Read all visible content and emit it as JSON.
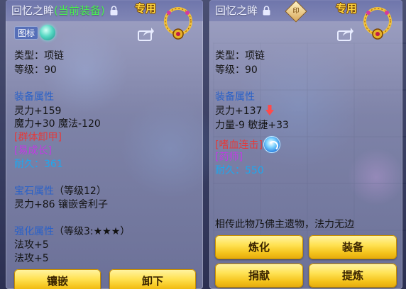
{
  "left_panel": {
    "title_name": "回忆之眸",
    "title_status": "(当前装备)",
    "exclusive_tag": "专用",
    "icon_label": "图标",
    "type": "类型：项链",
    "level": "等级：90",
    "equip_attr_header": "装备属性",
    "stat1": "灵力+159",
    "stat2": "魔力+30 魔法-120",
    "special_effect": "[群体卸甲]",
    "special_skill": "[易成长]",
    "durability_label": "耐久：",
    "durability_value": "361",
    "gem_header": "宝石属性",
    "gem_level": "（等级12）",
    "gem_stat": "灵力+86 镶嵌舍利子",
    "enhance_header": "强化属性",
    "enhance_level": "（等级3:★★★）",
    "enhance1": "法攻+5",
    "enhance2": "法攻+5",
    "buttons": {
      "inlay": "镶嵌",
      "unequip": "卸下"
    }
  },
  "right_panel": {
    "title_name": "回忆之眸",
    "seal_label": "印",
    "exclusive_tag": "专用",
    "type": "类型：项链",
    "level": "等级：90",
    "equip_attr_header": "装备属性",
    "stat1": "灵力+137",
    "stat2": "力量-9 敏捷+33",
    "special_effect": "[嗜血连击]",
    "special_skill": "[药师]",
    "durability_label": "耐久：",
    "durability_value": "550",
    "description": "相传此物乃佛主遗物，法力无边",
    "buttons": {
      "refine": "炼化",
      "equip": "装备",
      "donate": "捐献",
      "extract": "提炼"
    }
  },
  "colors": {
    "current_equipped": "#49ef52",
    "exclusive": "#ffd53d",
    "attr_header": "#2a61c8",
    "effect_red": "#e43a3a",
    "skill_purple": "#c13ae4",
    "durability": "#1ea7ee",
    "button_gold": "#f4c21a"
  },
  "icons": [
    "lock-icon",
    "share-icon",
    "necklace-icon",
    "arrow-down-icon",
    "skill-icon",
    "seal-icon",
    "gem-orb-icon"
  ]
}
